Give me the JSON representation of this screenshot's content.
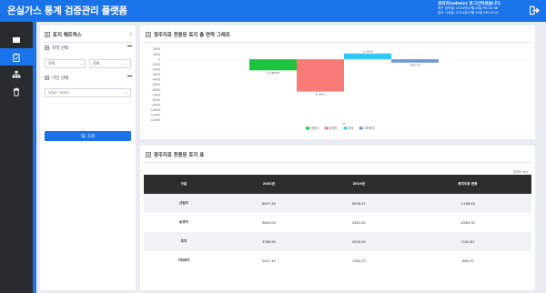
{
  "header": {
    "title": "온실가스 통계 검증관리 플랫폼",
    "user_line": "관리자(admin) 로그인하셨습니다.",
    "last_access": "최근 접속일: 2024년07월02일 PM 02:48",
    "current_access": "접속 시작일: 2024년07월 02일 PM 03:47",
    "brand_color": "#1a73e8"
  },
  "sidebar": {
    "items": [
      {
        "icon": "book-icon",
        "active": false
      },
      {
        "icon": "clipboard-check-icon",
        "active": true
      },
      {
        "icon": "org-chart-icon",
        "active": false
      },
      {
        "icon": "trash-icon",
        "active": false
      }
    ]
  },
  "filter": {
    "title": "토지 매트릭스",
    "region_label": "지역 선택",
    "region_select_1": "선택",
    "region_select_2": "전체",
    "period_label": "기간 선택",
    "period_value": "2002~2019",
    "search_label": "조회"
  },
  "chart_panel": {
    "title": "정주지로 전용된 토지 총 면적 그래프"
  },
  "table_panel": {
    "title": "정주지로 전용된 토지 표",
    "unit": "(단위: ha)",
    "columns": [
      "구분",
      "2002년",
      "2019년",
      "토지이용 변화"
    ],
    "rows": [
      [
        "산림지",
        "8697.36",
        "6508.52",
        "-2188.84"
      ],
      [
        "농경지",
        "9645.00",
        "3282.00",
        "-6363.00"
      ],
      [
        "초지",
        "3786.98",
        "4926.39",
        "1140.61"
      ],
      [
        "기타토지",
        "2447.10",
        "1784.13",
        "-662.97"
      ]
    ]
  },
  "chart_data": {
    "type": "bar",
    "categories": [
      "S"
    ],
    "series": [
      {
        "name": "산림지",
        "values": [
          -2188.84
        ],
        "color": "#1dc43d"
      },
      {
        "name": "농경지",
        "values": [
          -6363.0
        ],
        "color": "#f77a76"
      },
      {
        "name": "초지",
        "values": [
          1140.61
        ],
        "color": "#34c8f5"
      },
      {
        "name": "기타토지",
        "values": [
          -662.97
        ],
        "color": "#6f97d6"
      }
    ],
    "data_labels": [
      "-2,188.84",
      "-6,363.0",
      "1,140.6",
      "-662.97"
    ],
    "yticks": [
      2000,
      1000,
      0,
      -1000,
      -2000,
      -3000,
      -4000,
      -5000,
      -6000,
      -7000,
      -8000,
      -9000,
      -10000,
      -11000,
      -12000
    ],
    "ylim": [
      -12000,
      2000
    ],
    "grid": false,
    "legend_position": "bottom"
  }
}
